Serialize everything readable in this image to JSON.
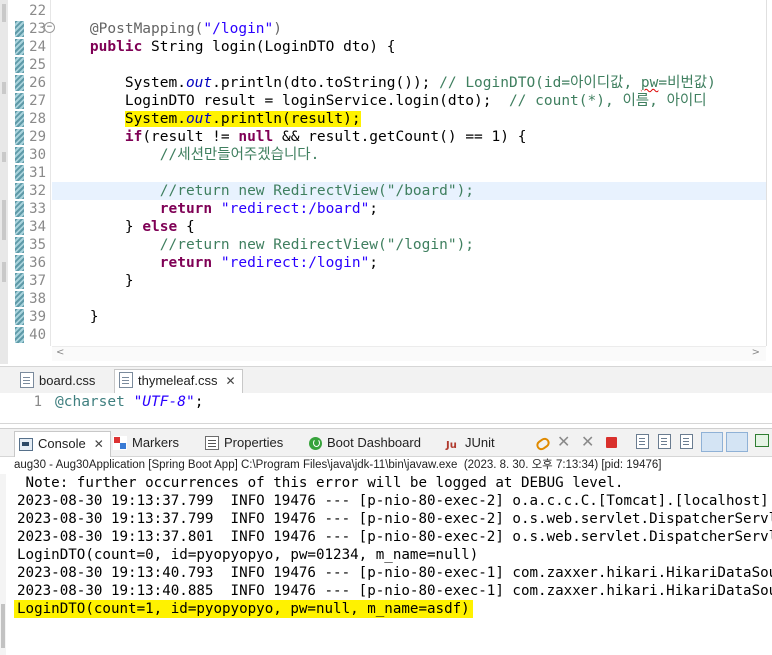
{
  "editor": {
    "lines": [
      {
        "num": "22",
        "code": ""
      },
      {
        "num": "23",
        "fold": "⊖",
        "segments": [
          {
            "t": "    "
          },
          {
            "t": "@PostMapping(",
            "c": "ann"
          },
          {
            "t": "\"/login\"",
            "c": "str"
          },
          {
            "t": ")",
            "c": "ann"
          }
        ]
      },
      {
        "num": "24",
        "segments": [
          {
            "t": "    "
          },
          {
            "t": "public",
            "c": "kw"
          },
          {
            "t": " String login(LoginDTO dto) {"
          }
        ]
      },
      {
        "num": "25",
        "code": ""
      },
      {
        "num": "26",
        "segments": [
          {
            "t": "        System."
          },
          {
            "t": "out",
            "c": "fld"
          },
          {
            "t": ".println(dto.toString()); "
          },
          {
            "t": "// LoginDTO(id=아이디값, ",
            "c": "cmt"
          },
          {
            "t": "pw",
            "c": "cmt squig"
          },
          {
            "t": "=비번값)",
            "c": "cmt"
          }
        ]
      },
      {
        "num": "27",
        "segments": [
          {
            "t": "        LoginDTO result = loginService.login(dto);  "
          },
          {
            "t": "// count(*), 이름, 아이디",
            "c": "cmt"
          }
        ]
      },
      {
        "num": "28",
        "segments": [
          {
            "t": "        "
          },
          {
            "t": "System.",
            "c": "hl"
          },
          {
            "t": "out",
            "c": "fld hl"
          },
          {
            "t": ".println(result);",
            "c": "hl"
          }
        ]
      },
      {
        "num": "29",
        "segments": [
          {
            "t": "        "
          },
          {
            "t": "if",
            "c": "kw"
          },
          {
            "t": "(result != "
          },
          {
            "t": "null",
            "c": "kw"
          },
          {
            "t": " && result.getCount() == 1) {"
          }
        ]
      },
      {
        "num": "30",
        "segments": [
          {
            "t": "            "
          },
          {
            "t": "//세션만들어주겠습니다.",
            "c": "cmt"
          }
        ]
      },
      {
        "num": "31",
        "code": ""
      },
      {
        "num": "32",
        "current": true,
        "segments": [
          {
            "t": "            "
          },
          {
            "t": "//return new RedirectView(\"/board\");",
            "c": "cmt"
          }
        ]
      },
      {
        "num": "33",
        "segments": [
          {
            "t": "            "
          },
          {
            "t": "return",
            "c": "kw"
          },
          {
            "t": " "
          },
          {
            "t": "\"redirect:/board\"",
            "c": "str"
          },
          {
            "t": ";"
          }
        ]
      },
      {
        "num": "34",
        "segments": [
          {
            "t": "        } "
          },
          {
            "t": "else",
            "c": "kw"
          },
          {
            "t": " {"
          }
        ]
      },
      {
        "num": "35",
        "segments": [
          {
            "t": "            "
          },
          {
            "t": "//return new RedirectView(\"/login\");",
            "c": "cmt"
          }
        ]
      },
      {
        "num": "36",
        "segments": [
          {
            "t": "            "
          },
          {
            "t": "return",
            "c": "kw"
          },
          {
            "t": " "
          },
          {
            "t": "\"redirect:/login\"",
            "c": "str"
          },
          {
            "t": ";"
          }
        ]
      },
      {
        "num": "37",
        "segments": [
          {
            "t": "        }"
          }
        ]
      },
      {
        "num": "38",
        "code": ""
      },
      {
        "num": "39",
        "segments": [
          {
            "t": "    }"
          }
        ]
      },
      {
        "num": "40",
        "code": ""
      }
    ],
    "scroll_left": "<",
    "scroll_right": ">"
  },
  "css_tabs": [
    {
      "label": "board.css",
      "active": false
    },
    {
      "label": "thymeleaf.css",
      "active": true,
      "close": "✕"
    }
  ],
  "css_editor": {
    "line_num": "1",
    "at_rule": "@charset",
    "value": "\"UTF-8\"",
    "end": ";"
  },
  "console_view": {
    "tabs": [
      {
        "label": "Console",
        "icon": "console-icon",
        "active": true,
        "close": "✕"
      },
      {
        "label": "Markers",
        "icon": "markers-icon"
      },
      {
        "label": "Properties",
        "icon": "properties-icon"
      },
      {
        "label": "Boot Dashboard",
        "icon": "spring-boot-icon"
      },
      {
        "label": "JUnit",
        "icon": "junit-icon"
      }
    ],
    "toolbar_icons": [
      "link-icon",
      "remove-launch-icon",
      "remove-all-icon",
      "terminate-icon",
      "clear-console-icon",
      "scroll-lock-icon",
      "word-wrap-icon",
      "show-on-output-icon",
      "show-on-error-icon",
      "new-console-icon"
    ],
    "title": "aug30 - Aug30Application [Spring Boot App] C:\\Program Files\\java\\jdk-11\\bin\\javaw.exe  (2023. 8. 30. 오후 7:13:34) [pid: 19476]",
    "lines": [
      " Note: further occurrences of this error will be logged at DEBUG level.",
      "2023-08-30 19:13:37.799  INFO 19476 --- [p-nio-80-exec-2] o.a.c.c.C.[Tomcat].[localhost].[/]",
      "2023-08-30 19:13:37.799  INFO 19476 --- [p-nio-80-exec-2] o.s.web.servlet.DispatcherServlet",
      "2023-08-30 19:13:37.801  INFO 19476 --- [p-nio-80-exec-2] o.s.web.servlet.DispatcherServlet",
      "LoginDTO(count=0, id=pyopyopyo, pw=01234, m_name=null)",
      "2023-08-30 19:13:40.793  INFO 19476 --- [p-nio-80-exec-1] com.zaxxer.hikari.HikariDataSource",
      "2023-08-30 19:13:40.885  INFO 19476 --- [p-nio-80-exec-1] com.zaxxer.hikari.HikariDataSource",
      "LoginDTO(count=1, id=pyopyopyo, pw=null, m_name=asdf)"
    ]
  },
  "colors": {
    "highlight": "#fff200",
    "keyword": "#7f0055",
    "string": "#2a00ff",
    "comment": "#3f7f5f",
    "field": "#0000c0",
    "current_line": "#e8f2fe"
  }
}
